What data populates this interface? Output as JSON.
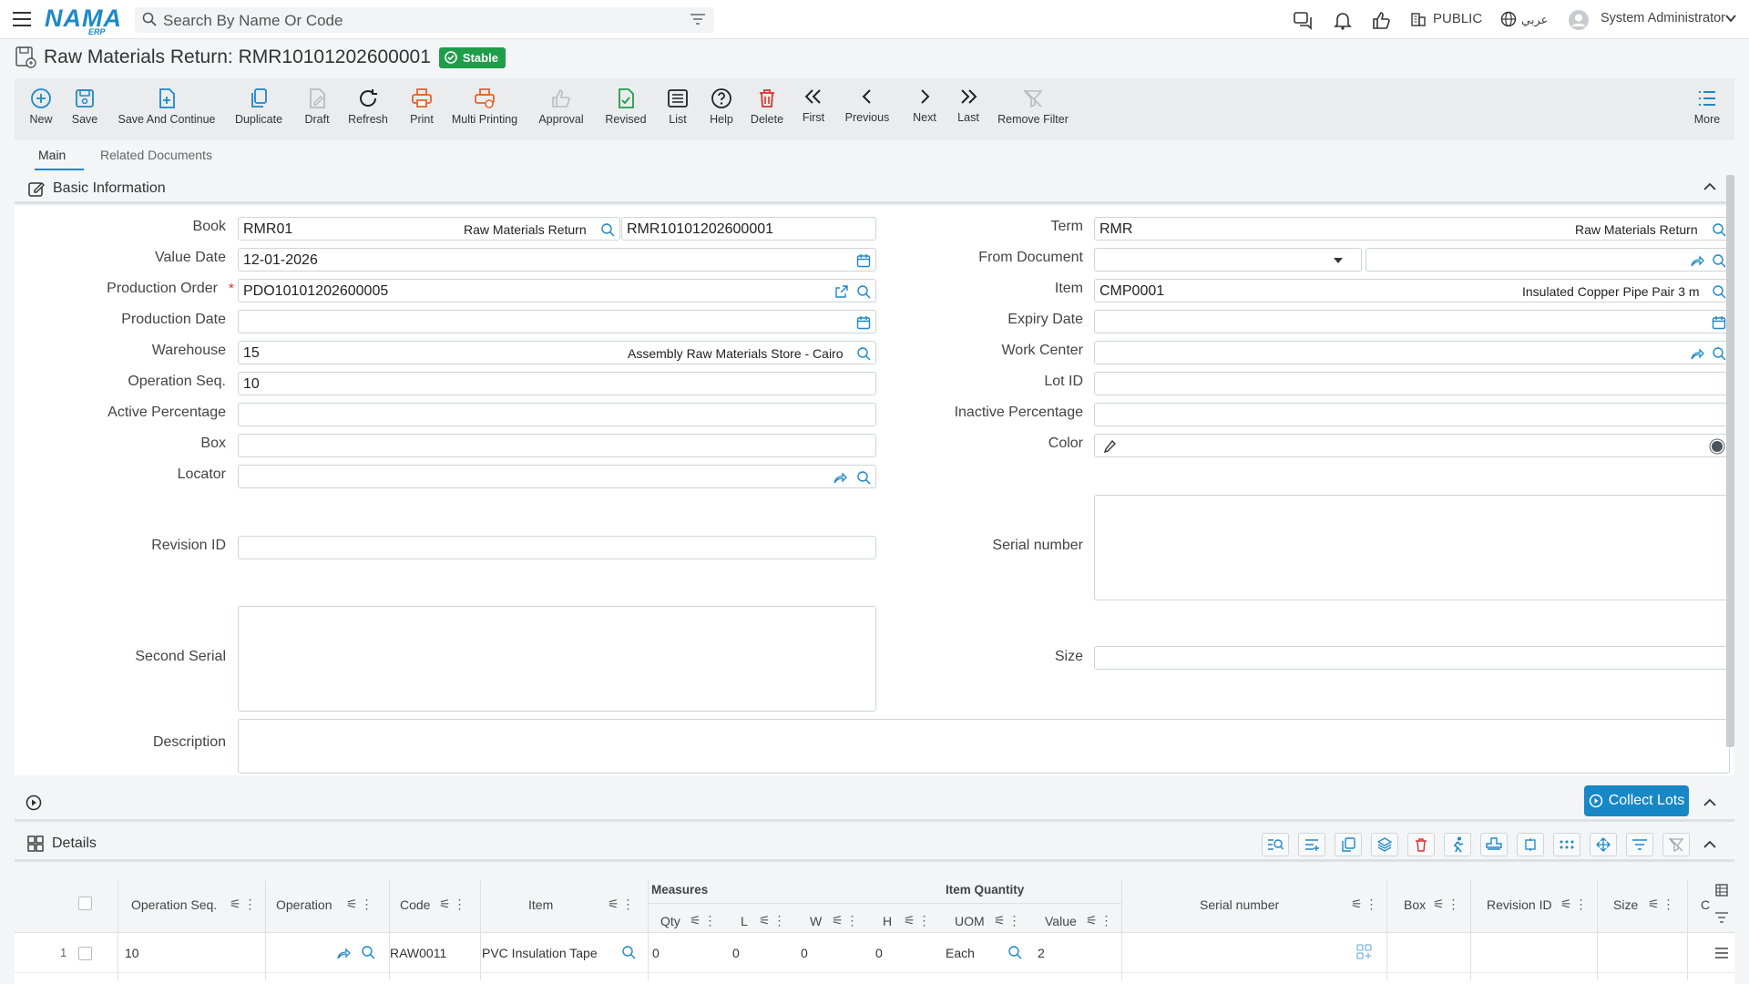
{
  "topbar": {
    "logo": "NAMA",
    "logo_sub": "ERP",
    "search_placeholder": "Search By Name Or Code",
    "env": "PUBLIC",
    "language": "عربي",
    "user": "System Administrator"
  },
  "page": {
    "title": "Raw Materials Return: RMR10101202600001",
    "status": "Stable"
  },
  "toolbar": {
    "buttons": [
      "New",
      "Save",
      "Save And Continue",
      "Duplicate",
      "Draft",
      "Refresh",
      "Print",
      "Multi Printing",
      "Approval",
      "Revised",
      "List",
      "Help",
      "Delete",
      "First",
      "Previous",
      "Next",
      "Last",
      "Remove Filter",
      "More"
    ]
  },
  "tabs": [
    "Main",
    "Related Documents"
  ],
  "sections": {
    "basic": "Basic Information",
    "details": "Details",
    "collect_lots": "Collect Lots"
  },
  "form": {
    "labels": {
      "book": "Book",
      "value_date": "Value Date",
      "production_order": "Production Order",
      "production_date": "Production Date",
      "warehouse": "Warehouse",
      "operation_seq": "Operation Seq.",
      "active_percentage": "Active Percentage",
      "box": "Box",
      "locator": "Locator",
      "revision_id": "Revision ID",
      "second_serial": "Second Serial",
      "description": "Description",
      "term": "Term",
      "from_document": "From Document",
      "item": "Item",
      "expiry_date": "Expiry Date",
      "work_center": "Work Center",
      "lot_id": "Lot ID",
      "inactive_percentage": "Inactive Percentage",
      "color": "Color",
      "serial_number": "Serial number",
      "size": "Size"
    },
    "values": {
      "book_code": "RMR01",
      "book_desc": "Raw Materials Return",
      "book_number": "RMR10101202600001",
      "value_date": "12-01-2026",
      "production_order": "PDO10101202600005",
      "warehouse_code": "15",
      "warehouse_desc": "Assembly Raw Materials Store - Cairo",
      "operation_seq": "10",
      "term_code": "RMR",
      "term_desc": "Raw Materials Return",
      "item_code": "CMP0001",
      "item_desc": "Insulated Copper Pipe Pair 3 m"
    }
  },
  "grid": {
    "group_measures": "Measures",
    "group_item_qty": "Item Quantity",
    "headers": {
      "operation_seq": "Operation Seq.",
      "operation": "Operation",
      "code": "Code",
      "item": "Item",
      "qty": "Qty",
      "l": "L",
      "w": "W",
      "h": "H",
      "uom": "UOM",
      "value": "Value",
      "serial": "Serial number",
      "box": "Box",
      "revision": "Revision ID",
      "size": "Size",
      "c": "C"
    },
    "rows": [
      {
        "index": "1",
        "operation_seq": "10",
        "code": "RAW0011",
        "item": "PVC Insulation Tape",
        "qty": "0",
        "l": "0",
        "w": "0",
        "h": "0",
        "uom": "Each",
        "value": "2"
      }
    ]
  }
}
